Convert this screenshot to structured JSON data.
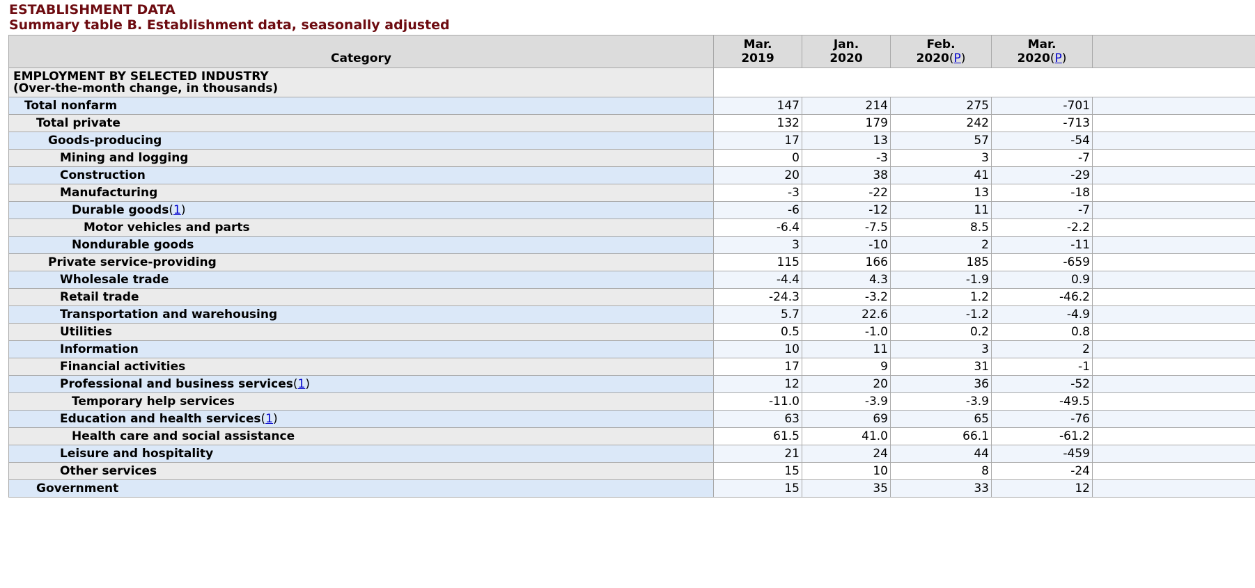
{
  "section_title": "ESTABLISHMENT DATA",
  "table_title": "Summary table B. Establishment data, seasonally adjusted",
  "columns": {
    "category": "Category",
    "c1": {
      "l1": "Mar.",
      "l2": "2019"
    },
    "c2": {
      "l1": "Jan.",
      "l2": "2020"
    },
    "c3": {
      "l1": "Feb.",
      "l2": "2020",
      "fn": "P"
    },
    "c4": {
      "l1": "Mar.",
      "l2": "2020",
      "fn": "P"
    }
  },
  "section": {
    "line1": "EMPLOYMENT BY SELECTED INDUSTRY",
    "line2": "(Over-the-month change, in thousands)"
  },
  "footnote_mark": "1",
  "rows": [
    {
      "label": "Total nonfarm",
      "values": [
        "147",
        "214",
        "275",
        "-701"
      ]
    },
    {
      "label": "Total private",
      "values": [
        "132",
        "179",
        "242",
        "-713"
      ]
    },
    {
      "label": "Goods-producing",
      "values": [
        "17",
        "13",
        "57",
        "-54"
      ]
    },
    {
      "label": "Mining and logging",
      "values": [
        "0",
        "-3",
        "3",
        "-7"
      ]
    },
    {
      "label": "Construction",
      "values": [
        "20",
        "38",
        "41",
        "-29"
      ]
    },
    {
      "label": "Manufacturing",
      "values": [
        "-3",
        "-22",
        "13",
        "-18"
      ]
    },
    {
      "label": "Durable goods",
      "values": [
        "-6",
        "-12",
        "11",
        "-7"
      ]
    },
    {
      "label": "Motor vehicles and parts",
      "values": [
        "-6.4",
        "-7.5",
        "8.5",
        "-2.2"
      ]
    },
    {
      "label": "Nondurable goods",
      "values": [
        "3",
        "-10",
        "2",
        "-11"
      ]
    },
    {
      "label": "Private service-providing",
      "values": [
        "115",
        "166",
        "185",
        "-659"
      ]
    },
    {
      "label": "Wholesale trade",
      "values": [
        "-4.4",
        "4.3",
        "-1.9",
        "0.9"
      ]
    },
    {
      "label": "Retail trade",
      "values": [
        "-24.3",
        "-3.2",
        "1.2",
        "-46.2"
      ]
    },
    {
      "label": "Transportation and warehousing",
      "values": [
        "5.7",
        "22.6",
        "-1.2",
        "-4.9"
      ]
    },
    {
      "label": "Utilities",
      "values": [
        "0.5",
        "-1.0",
        "0.2",
        "0.8"
      ]
    },
    {
      "label": "Information",
      "values": [
        "10",
        "11",
        "3",
        "2"
      ]
    },
    {
      "label": "Financial activities",
      "values": [
        "17",
        "9",
        "31",
        "-1"
      ]
    },
    {
      "label": "Professional and business services",
      "values": [
        "12",
        "20",
        "36",
        "-52"
      ]
    },
    {
      "label": "Temporary help services",
      "values": [
        "-11.0",
        "-3.9",
        "-3.9",
        "-49.5"
      ]
    },
    {
      "label": "Education and health services",
      "values": [
        "63",
        "69",
        "65",
        "-76"
      ]
    },
    {
      "label": "Health care and social assistance",
      "values": [
        "61.5",
        "41.0",
        "66.1",
        "-61.2"
      ]
    },
    {
      "label": "Leisure and hospitality",
      "values": [
        "21",
        "24",
        "44",
        "-459"
      ]
    },
    {
      "label": "Other services",
      "values": [
        "15",
        "10",
        "8",
        "-24"
      ]
    },
    {
      "label": "Government",
      "values": [
        "15",
        "35",
        "33",
        "12"
      ]
    }
  ]
}
